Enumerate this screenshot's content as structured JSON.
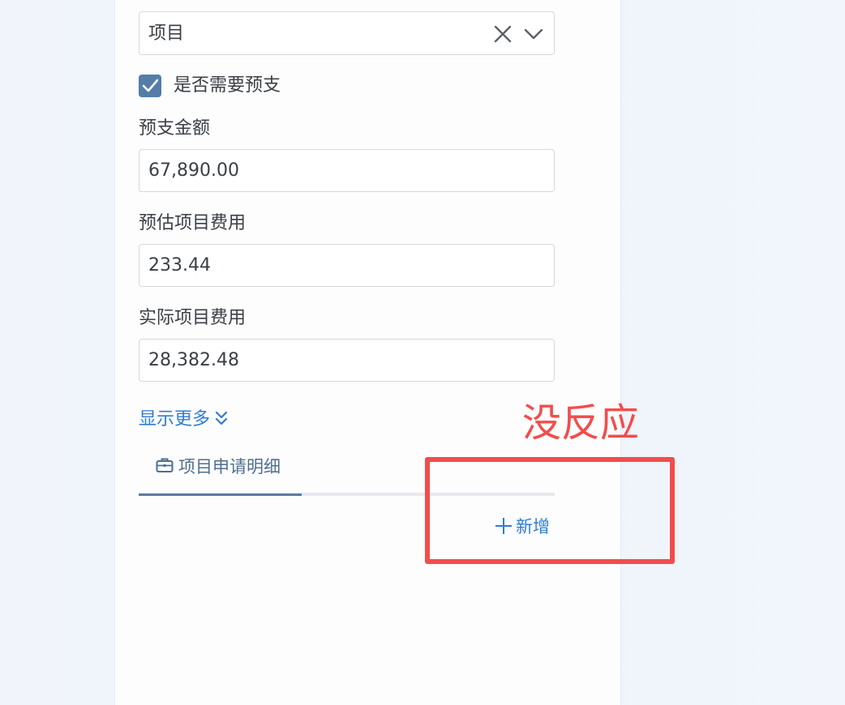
{
  "form": {
    "project_select": {
      "value": "项目"
    },
    "prepay_checkbox": {
      "label": "是否需要预支",
      "checked": true
    },
    "fields": [
      {
        "label": "预支金额",
        "value": "67,890.00"
      },
      {
        "label": "预估项目费用",
        "value": "233.44"
      },
      {
        "label": "实际项目费用",
        "value": "28,382.48"
      }
    ],
    "show_more_label": "显示更多"
  },
  "tabs": [
    {
      "label": "项目申请明细",
      "icon": "briefcase-icon",
      "active": true
    }
  ],
  "detail": {
    "add_label": "新增"
  },
  "annotation": {
    "text": "没反应",
    "color": "#f34c4c"
  },
  "colors": {
    "accent": "#2f7dd1",
    "checkbox": "#557da8",
    "tab_text": "#4e6e8e"
  }
}
